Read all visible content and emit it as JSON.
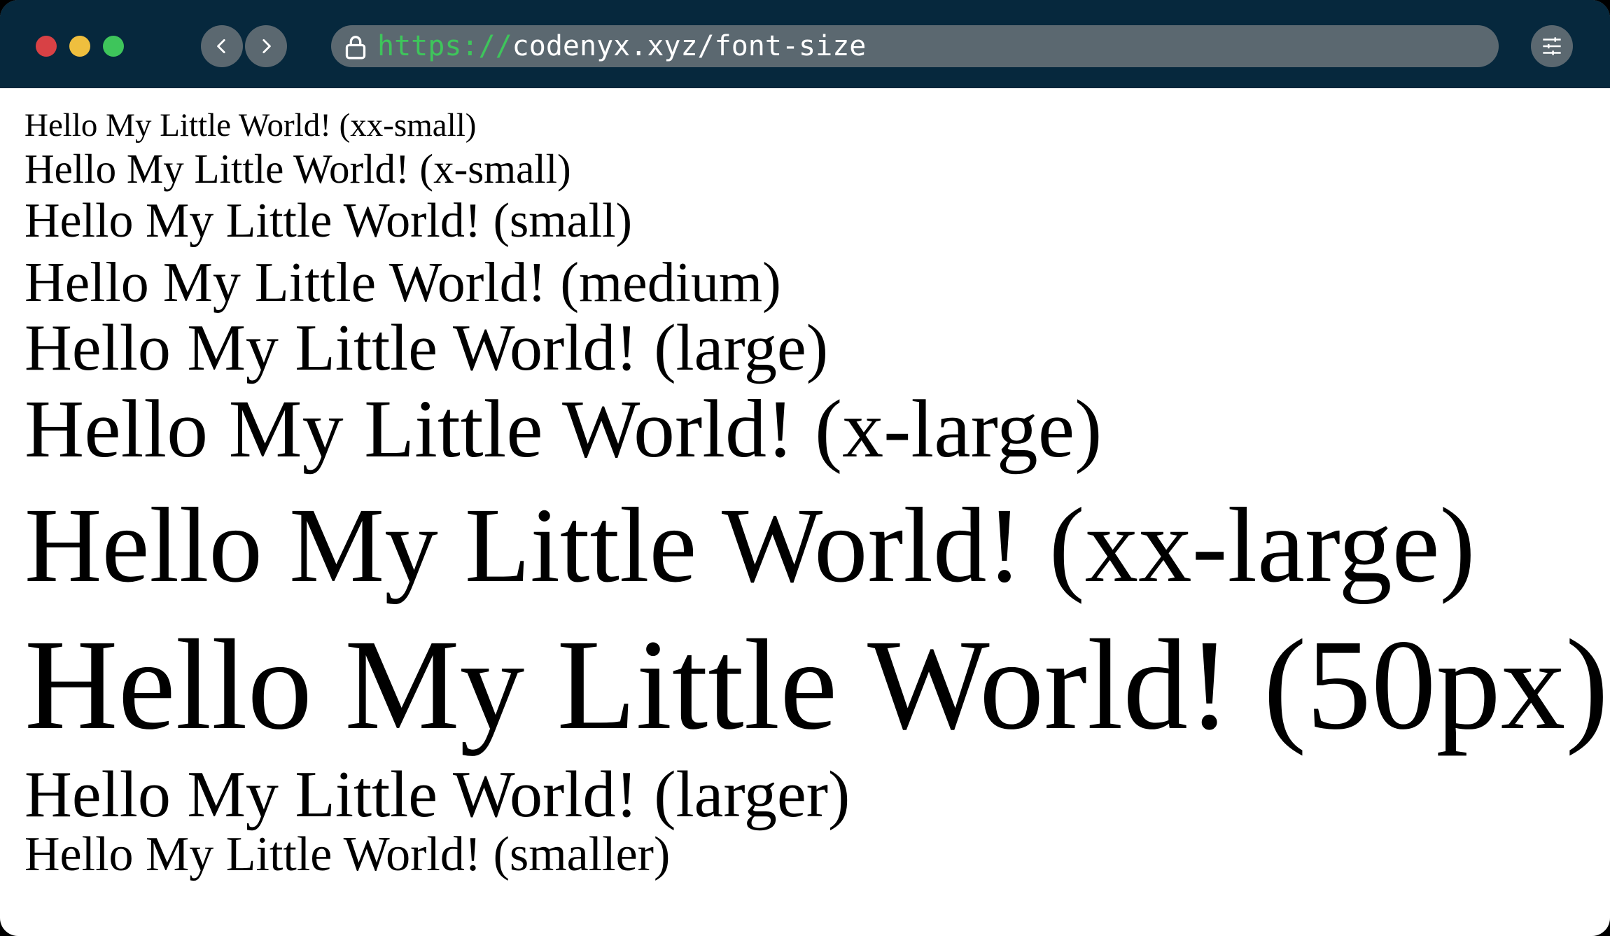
{
  "browser": {
    "url_scheme": "https://",
    "url_rest": "codenyx.xyz/font-size",
    "icons": {
      "back": "chevron-left-icon",
      "forward": "chevron-right-icon",
      "lock": "lock-icon",
      "settings": "sliders-icon"
    },
    "colors": {
      "toolbar": "#06283d",
      "control": "#5b6870",
      "close": "#d84145",
      "minimize": "#efbf3e",
      "maximize": "#3ec55b",
      "scheme_text": "#3ec55b"
    }
  },
  "page": {
    "lines": [
      "Hello My Little World! (xx-small)",
      "Hello My Little World! (x-small)",
      "Hello My Little World! (small)",
      "Hello My Little World! (medium)",
      "Hello My Little World! (large)",
      "Hello My Little World! (x-large)",
      "Hello My Little World! (xx-large)",
      "Hello My Little World! (50px)",
      "Hello My Little World! (larger)",
      "Hello My Little World! (smaller)"
    ]
  }
}
